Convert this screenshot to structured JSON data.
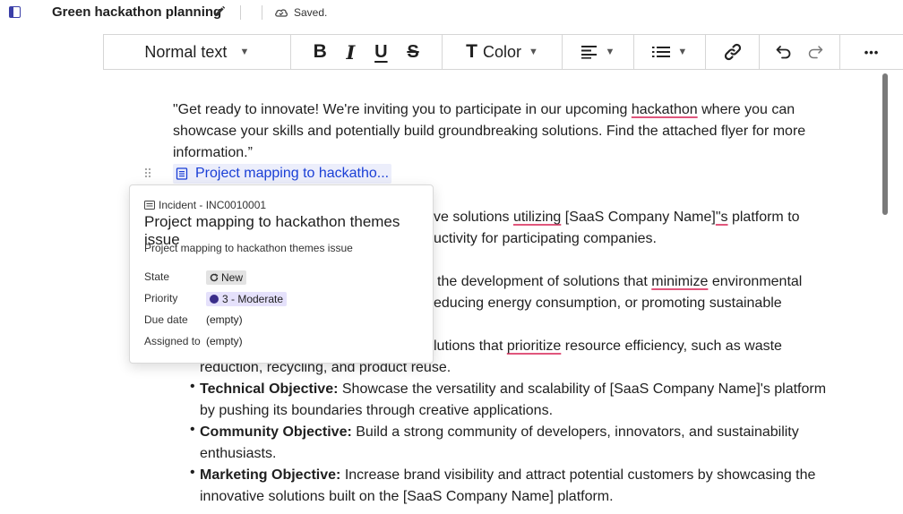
{
  "topbar": {
    "title": "Green hackathon planning",
    "save_status": "Saved."
  },
  "toolbar": {
    "text_style": "Normal text",
    "bold": "B",
    "italic": "I",
    "underline": "U",
    "strike": "S",
    "color_glyph": "T",
    "color_label": "Color",
    "more": "•••"
  },
  "document": {
    "intro_line1_a": "\"Get ready to innovate! We're inviting you to participate in our upcoming ",
    "intro_line1_link": "hackathon",
    "intro_line1_b": " where you can",
    "intro_line2": "showcase your skills and potentially build groundbreaking solutions. Find the attached flyer for more",
    "intro_line3": "information.”",
    "linked_item": "Project mapping to hackatho...",
    "p1_line1_a": "ve solutions ",
    "p1_line1_sq": "utilizing",
    "p1_line1_b": " [SaaS Company Name]",
    "p1_line1_sq2": "\"s",
    "p1_line1_c": " platform to",
    "p1_line2": "uctivity for participating companies.",
    "p2_line1_a": "the development of solutions that ",
    "p2_line1_sq": "minimize",
    "p2_line1_b": " environmental",
    "p2_line2": "educing energy consumption, or promoting sustainable",
    "p3_line1_a": "lutions that ",
    "p3_line1_sq": "prioritize",
    "p3_line1_b": " resource efficiency, such as waste",
    "p3_line2": "reduction, recycling, and product reuse.",
    "bullets": [
      {
        "label": "Technical Objective:",
        "line1": " Showcase the versatility and scalability of [SaaS Company Name]'s platform",
        "line2": "by pushing its boundaries through creative applications."
      },
      {
        "label": "Community Objective:",
        "line1": " Build a strong community of developers, innovators, and sustainability",
        "line2": "enthusiasts."
      },
      {
        "label": "Marketing Objective:",
        "line1": " Increase brand visibility and attract potential customers by showcasing the",
        "line2": "innovative solutions built on the [SaaS Company Name] platform."
      }
    ]
  },
  "popover": {
    "record_meta": "Incident - INC0010001",
    "title": "Project mapping to hackathon themes issue",
    "description": "Project mapping to hackathon themes issue",
    "fields": {
      "state_label": "State",
      "state_value": "New",
      "priority_label": "Priority",
      "priority_value": "3 - Moderate",
      "due_label": "Due date",
      "due_value": "(empty)",
      "assigned_label": "Assigned to",
      "assigned_value": "(empty)"
    }
  },
  "colors": {
    "accent": "#3b3fa8",
    "link": "#1a3fd6",
    "spellcheck": "#e0567c",
    "priority_dot": "#3a2d8a"
  },
  "icons": [
    "sidebar-toggle-icon",
    "pencil-icon",
    "cloud-check-icon",
    "align-icon",
    "list-icon",
    "link-icon",
    "undo-icon",
    "redo-icon",
    "document-icon",
    "drag-handle-icon",
    "refresh-icon"
  ]
}
